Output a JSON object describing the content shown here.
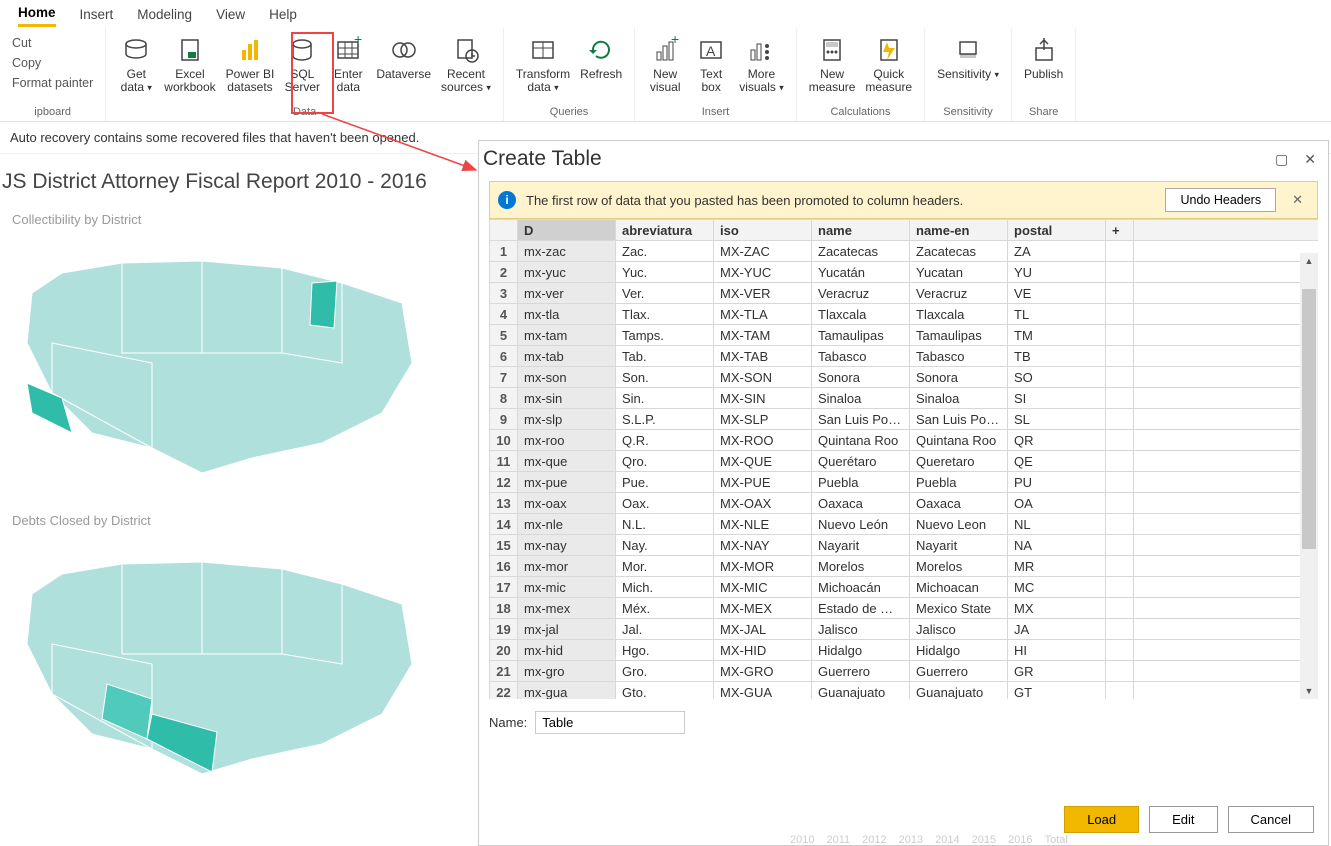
{
  "tabs": [
    "Home",
    "Insert",
    "Modeling",
    "View",
    "Help"
  ],
  "activeTab": "Home",
  "ribbon": {
    "clipboard": {
      "cut": "Cut",
      "copy": "Copy",
      "format": "Format painter",
      "groupLabel": "ipboard"
    },
    "data": {
      "items": [
        {
          "label": "Get\ndata",
          "caret": true,
          "name": "get-data"
        },
        {
          "label": "Excel\nworkbook",
          "name": "excel-workbook"
        },
        {
          "label": "Power BI\ndatasets",
          "name": "powerbi-datasets"
        },
        {
          "label": "SQL\nServer",
          "name": "sql-server"
        },
        {
          "label": "Enter\ndata",
          "name": "enter-data"
        },
        {
          "label": "Dataverse",
          "name": "dataverse"
        },
        {
          "label": "Recent\nsources",
          "caret": true,
          "name": "recent-sources"
        }
      ],
      "groupLabel": "Data"
    },
    "queries": {
      "items": [
        {
          "label": "Transform\ndata",
          "caret": true,
          "name": "transform-data"
        },
        {
          "label": "Refresh",
          "name": "refresh"
        }
      ],
      "groupLabel": "Queries"
    },
    "insert": {
      "items": [
        {
          "label": "New\nvisual",
          "name": "new-visual"
        },
        {
          "label": "Text\nbox",
          "name": "text-box"
        },
        {
          "label": "More\nvisuals",
          "caret": true,
          "name": "more-visuals"
        }
      ],
      "groupLabel": "Insert"
    },
    "calc": {
      "items": [
        {
          "label": "New\nmeasure",
          "name": "new-measure"
        },
        {
          "label": "Quick\nmeasure",
          "name": "quick-measure"
        }
      ],
      "groupLabel": "Calculations"
    },
    "sens": {
      "items": [
        {
          "label": "Sensitivity",
          "caret": true,
          "name": "sensitivity"
        }
      ],
      "groupLabel": "Sensitivity"
    },
    "share": {
      "items": [
        {
          "label": "Publish",
          "name": "publish"
        }
      ],
      "groupLabel": "Share"
    }
  },
  "recoveryMsg": "Auto recovery contains some recovered files that haven't been opened.",
  "report": {
    "title": "JS District Attorney Fiscal Report 2010 - 2016",
    "chart1": "Collectibility by District",
    "chart2": "Debts Closed by District",
    "years": [
      "2010",
      "2011",
      "2012",
      "2013",
      "2014",
      "2015",
      "2016",
      "Total"
    ]
  },
  "dialog": {
    "title": "Create Table",
    "infoMsg": "The first row of data that you pasted has been promoted to column headers.",
    "undoBtn": "Undo Headers",
    "headers": [
      "D",
      "abreviatura",
      "iso",
      "name",
      "name-en",
      "postal"
    ],
    "addCol": "+",
    "rows": [
      [
        "mx-zac",
        "Zac.",
        "MX-ZAC",
        "Zacatecas",
        "Zacatecas",
        "ZA"
      ],
      [
        "mx-yuc",
        "Yuc.",
        "MX-YUC",
        "Yucatán",
        "Yucatan",
        "YU"
      ],
      [
        "mx-ver",
        "Ver.",
        "MX-VER",
        "Veracruz",
        "Veracruz",
        "VE"
      ],
      [
        "mx-tla",
        "Tlax.",
        "MX-TLA",
        "Tlaxcala",
        "Tlaxcala",
        "TL"
      ],
      [
        "mx-tam",
        "Tamps.",
        "MX-TAM",
        "Tamaulipas",
        "Tamaulipas",
        "TM"
      ],
      [
        "mx-tab",
        "Tab.",
        "MX-TAB",
        "Tabasco",
        "Tabasco",
        "TB"
      ],
      [
        "mx-son",
        "Son.",
        "MX-SON",
        "Sonora",
        "Sonora",
        "SO"
      ],
      [
        "mx-sin",
        "Sin.",
        "MX-SIN",
        "Sinaloa",
        "Sinaloa",
        "SI"
      ],
      [
        "mx-slp",
        "S.L.P.",
        "MX-SLP",
        "San Luis Potosí",
        "San Luis Potosi",
        "SL"
      ],
      [
        "mx-roo",
        "Q.R.",
        "MX-ROO",
        "Quintana Roo",
        "Quintana Roo",
        "QR"
      ],
      [
        "mx-que",
        "Qro.",
        "MX-QUE",
        "Querétaro",
        "Queretaro",
        "QE"
      ],
      [
        "mx-pue",
        "Pue.",
        "MX-PUE",
        "Puebla",
        "Puebla",
        "PU"
      ],
      [
        "mx-oax",
        "Oax.",
        "MX-OAX",
        "Oaxaca",
        "Oaxaca",
        "OA"
      ],
      [
        "mx-nle",
        "N.L.",
        "MX-NLE",
        "Nuevo León",
        "Nuevo Leon",
        "NL"
      ],
      [
        "mx-nay",
        "Nay.",
        "MX-NAY",
        "Nayarit",
        "Nayarit",
        "NA"
      ],
      [
        "mx-mor",
        "Mor.",
        "MX-MOR",
        "Morelos",
        "Morelos",
        "MR"
      ],
      [
        "mx-mic",
        "Mich.",
        "MX-MIC",
        "Michoacán",
        "Michoacan",
        "MC"
      ],
      [
        "mx-mex",
        "Méx.",
        "MX-MEX",
        "Estado de Méxi...",
        "Mexico State",
        "MX"
      ],
      [
        "mx-jal",
        "Jal.",
        "MX-JAL",
        "Jalisco",
        "Jalisco",
        "JA"
      ],
      [
        "mx-hid",
        "Hgo.",
        "MX-HID",
        "Hidalgo",
        "Hidalgo",
        "HI"
      ],
      [
        "mx-gro",
        "Gro.",
        "MX-GRO",
        "Guerrero",
        "Guerrero",
        "GR"
      ],
      [
        "mx-gua",
        "Gto.",
        "MX-GUA",
        "Guanajuato",
        "Guanajuato",
        "GT"
      ]
    ],
    "nameLabel": "Name:",
    "nameValue": "Table",
    "buttons": {
      "load": "Load",
      "edit": "Edit",
      "cancel": "Cancel"
    }
  }
}
